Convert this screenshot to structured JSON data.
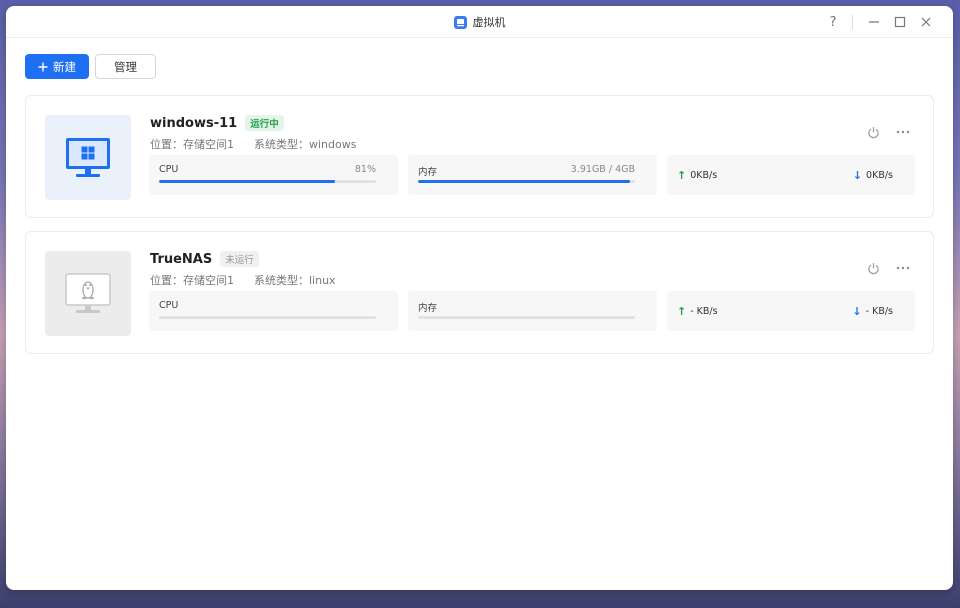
{
  "window": {
    "title": "虚拟机",
    "help": "?"
  },
  "toolbar": {
    "new_label": "新建",
    "manage_label": "管理"
  },
  "vms": [
    {
      "name": "windows-11",
      "status": "运行中",
      "location": "位置：存储空间1",
      "os_type": "系统类型：windows",
      "cpu_label": "CPU",
      "cpu_value": "81%",
      "cpu_fraction": 0.81,
      "mem_label": "内存",
      "mem_value": "3.91GB / 4GB",
      "mem_fraction": 0.9775,
      "upload": "0KB/s",
      "download": "0KB/s"
    },
    {
      "name": "TrueNAS",
      "status": "未运行",
      "location": "位置：存储空间1",
      "os_type": "系统类型：linux",
      "cpu_label": "CPU",
      "cpu_value": "",
      "cpu_fraction": 0,
      "mem_label": "内存",
      "mem_value": "",
      "mem_fraction": 0,
      "upload": "- KB/s",
      "download": "- KB/s"
    }
  ],
  "colors": {
    "accent": "#1e6ff1",
    "running": "#22a04a"
  }
}
